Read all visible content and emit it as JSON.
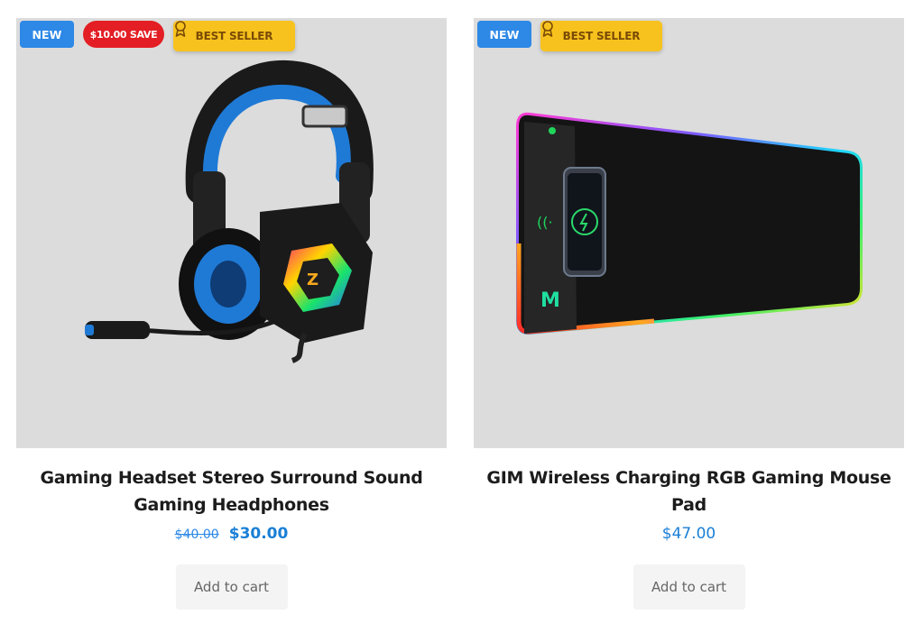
{
  "products": [
    {
      "badges": {
        "new": "NEW",
        "save": "$10.00 SAVE",
        "best": "BEST SELLER"
      },
      "title": "Gaming Headset Stereo Surround Sound Gaming Headphones",
      "price_old": "$40.00",
      "price_new": "$30.00",
      "cart_label": "Add to cart"
    },
    {
      "badges": {
        "new": "NEW",
        "best": "BEST SELLER"
      },
      "title": "GIM Wireless Charging RGB Gaming Mouse Pad",
      "price": "$47.00",
      "cart_label": "Add to cart"
    }
  ],
  "colors": {
    "badge_new": "#2d88e6",
    "badge_save": "#e31e24",
    "badge_best": "#f7c21d",
    "price": "#1a7fd6",
    "image_bg": "#dcdcdc"
  },
  "icons": {
    "best_seller": "award-ribbon-icon"
  }
}
